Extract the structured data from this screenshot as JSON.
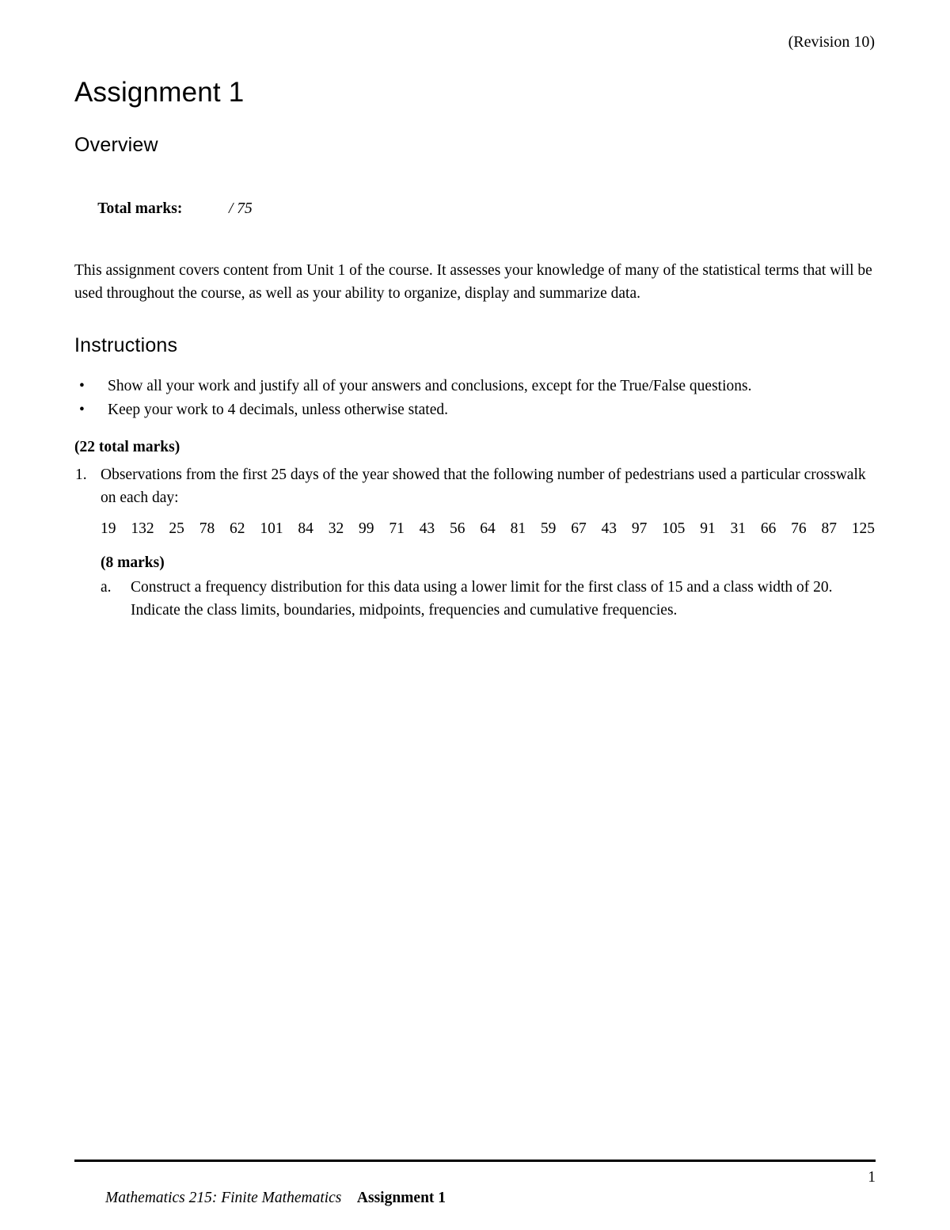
{
  "header": {
    "revision": "(Revision 10)"
  },
  "title": "Assignment 1",
  "overview": {
    "heading": "Overview",
    "marks_label": "Total marks:",
    "marks_value": "/ 75",
    "paragraph": "This assignment covers content from Unit 1 of the course. It assesses your knowledge of many of the statistical terms that will be used throughout the course, as well as your ability to organize, display and summarize data."
  },
  "instructions": {
    "heading": "Instructions",
    "bullet_glyph": "•",
    "items": [
      "Show all your work and justify all of your answers and conclusions, except for the True/False questions.",
      "Keep your work to 4 decimals, unless otherwise stated."
    ]
  },
  "questions": {
    "total_marks": "(22 total marks)",
    "q1": {
      "number": "1.",
      "text": "Observations from the first 25 days of the year showed that the following number of pedestrians used a particular crosswalk on each day:",
      "data": [
        19,
        132,
        25,
        78,
        62,
        101,
        84,
        32,
        99,
        71,
        43,
        56,
        64,
        81,
        59,
        67,
        43,
        97,
        105,
        91,
        31,
        66,
        76,
        87,
        125
      ],
      "sub_marks": "(8 marks)",
      "parts": [
        {
          "letter": "a.",
          "text": "Construct a frequency distribution for this data using a lower limit for the first class of 15 and a class width of 20. Indicate the class limits, boundaries, midpoints, frequencies and cumulative frequencies."
        }
      ]
    }
  },
  "footer": {
    "course": "Mathematics 215: Finite Mathematics",
    "assignment": "Assignment 1",
    "page_number": "1"
  }
}
